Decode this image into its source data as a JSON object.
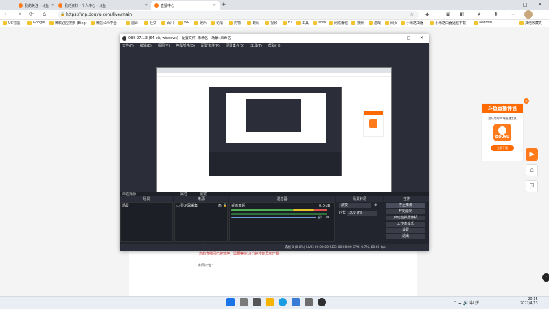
{
  "browser": {
    "tabs": [
      {
        "label": "我的关注 - 斗鱼",
        "active": false
      },
      {
        "label": "我的资料 - 个人中心 - 斗鱼",
        "active": false
      },
      {
        "label": "直播中心",
        "active": true
      }
    ],
    "new_tab": "+",
    "window_controls": [
      "—",
      "□",
      "✕"
    ],
    "nav": {
      "back": "←",
      "forward": "→",
      "reload": "⟳",
      "home": "⌂"
    },
    "url": "https://mp.douyu.com/live/main",
    "lock": "🔒",
    "bookmarks": [
      "UC导航",
      "Google",
      "微软必应搜索 (Bing)",
      "微信公众平台",
      "翻译",
      "社交",
      "百川",
      "WP",
      "娱乐",
      "论坛",
      "购物",
      "数码",
      "视频",
      "BT",
      "工具",
      "ahm",
      "网络编程",
      "搜索",
      "游戏",
      "网页",
      "小米路由器",
      "小米路由器远程下载",
      "android",
      "其他收藏夹"
    ]
  },
  "page": {
    "notice": "您的直播间已被暂停，需要等待10分钟才能再次开播",
    "room_notice_label": "房间公告：",
    "promo": {
      "title": "斗鱼直播伴侣",
      "subtitle": "超好用的PC端直播工具",
      "logo_text": "DOUYU",
      "download": "立即下载",
      "close": "×"
    },
    "side_icons": [
      "play-icon",
      "home-icon",
      "screenshot-icon"
    ]
  },
  "obs": {
    "title": "OBS 27.1.3 (64-bit, windows) - 配置文件: 未命名 - 场景: 未命名",
    "menu": [
      "文件(F)",
      "编辑(E)",
      "视图(V)",
      "停靠部件(D)",
      "配置文件(P)",
      "场景集合(S)",
      "工具(T)",
      "帮助(H)"
    ],
    "no_source": "未选择源",
    "properties": "属性",
    "filters": "滤镜",
    "docks": {
      "scenes": "场景",
      "sources": "来源",
      "mixer": "混音器",
      "transitions": "场景转场",
      "controls": "控件"
    },
    "scene_item": "场景",
    "source_item": "显示器采集",
    "mixer_item": "桌面音频",
    "mixer_db": "0.0 dB",
    "transition": {
      "type": "渐变",
      "duration_label": "时长",
      "duration": "300 ms"
    },
    "controls": [
      "停止推流",
      "开始录制",
      "启动虚拟摄像机",
      "工作室模式",
      "设置",
      "退出"
    ],
    "status": "丢帧 0 (0.0%)   LIVE: 00:00:00   REC: 00:00:00   CPU: 0.7%, 60.00 fps",
    "foot_icons": "+ — ⌃ ⌄"
  },
  "taskbar": {
    "time": "20:15",
    "date": "2022/4/13",
    "tray": "⌃ ☁ 🔊 中 拼"
  },
  "colors": {
    "accent": "#ff7a1a",
    "obs_bg": "#2b2e38",
    "notice": "#e03c3c"
  }
}
